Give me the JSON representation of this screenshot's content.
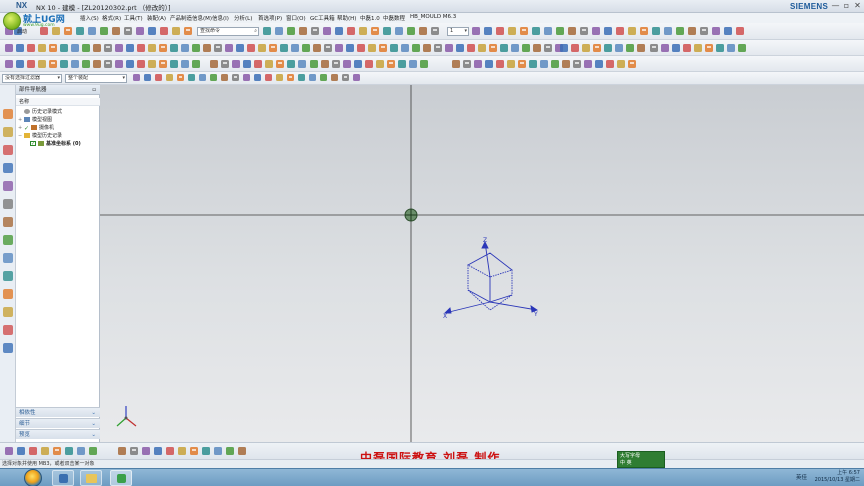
{
  "window": {
    "app_logo": "NX",
    "title": "NX 10 - 建模 - [ZL20120302.prt （修改的）]",
    "brand": "SIEMENS",
    "minimize": "—",
    "restore": "▫",
    "close": "✕"
  },
  "site_logo": {
    "title": "就上UG网",
    "url_text": "www.9ug.com"
  },
  "menu": [
    "文件(F)",
    "编辑(E)",
    "视图(V)",
    "插入(S)",
    "格式(R)",
    "工具(T)",
    "装配(A)",
    "产品制造信息(M)",
    "信息(I)",
    "分析(L)",
    "首选项(P)",
    "窗口(O)",
    "GC工具箱",
    "帮助(H)",
    "中磊1.0",
    "中磊数程",
    "HB_MOULD M6.3"
  ],
  "toolbar": {
    "start_label": "启动",
    "command_search_placeholder": "查找命令",
    "snap_count": "1",
    "filter_select": "没有选择过滤器",
    "assembly_select": "整个装配"
  },
  "part_navigator": {
    "title": "部件导航器",
    "column_name": "名称",
    "items": [
      {
        "label": "历史记录模式",
        "level": 0,
        "checked": false
      },
      {
        "label": "模型视图",
        "level": 0,
        "checked": false
      },
      {
        "label": "摄像机",
        "level": 0,
        "checked": true
      },
      {
        "label": "模型历史记录",
        "level": 0,
        "checked": false
      },
      {
        "label": "基准坐标系 (0)",
        "level": 1,
        "checked": true
      }
    ],
    "panels": [
      "相依性",
      "细节",
      "预览"
    ]
  },
  "viewport": {
    "csys_axes": [
      "X",
      "Y",
      "Z"
    ]
  },
  "watermark": "中磊国际教育  刘磊  制作",
  "status_text": "选择对象并使用 MB3，或者双击某一对象",
  "ime": {
    "mode": "大写字母",
    "sub": "中 英"
  },
  "tray": {
    "lang": "英佳"
  },
  "clock": {
    "time": "上午 6:57",
    "date": "2015/10/13 星期二"
  },
  "colors": {
    "titlebar": "#dfe5ec",
    "viewport_top": "#c9cdd2",
    "watermark": "#cc1111",
    "accent": "#1c5a9a"
  }
}
